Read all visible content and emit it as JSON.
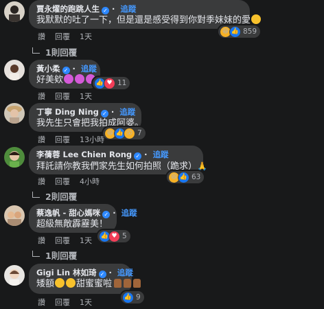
{
  "comments": [
    {
      "name": "賈永燿的跑跳人生",
      "verified_label": "✓",
      "follow_label": "追蹤",
      "text": "我默默的吐了一下，但是還是感受得到你對季妹妹的愛",
      "emoji_suffix": [
        "heart-eyes-emoji"
      ],
      "like_label": "讚",
      "reply_label": "回覆",
      "time": "1天",
      "reactions": [
        "haha",
        "like"
      ],
      "reaction_count": "859",
      "replies_label": "1則回覆"
    },
    {
      "name": "黃小柔",
      "verified_label": "✓",
      "follow_label": "追蹤",
      "text": "好美欸",
      "emoji_suffix": [
        "devil-emoji",
        "devil-emoji",
        "devil-emoji"
      ],
      "like_label": "讚",
      "reply_label": "回覆",
      "time": "1天",
      "reactions": [
        "like",
        "love"
      ],
      "reaction_count": "11"
    },
    {
      "name": "丁寧 Ding Ning",
      "verified_label": "✓",
      "follow_label": "追蹤",
      "text": "我先生只會把我拍成阿婆。",
      "like_label": "讚",
      "reply_label": "回覆",
      "time": "13小時",
      "reactions": [
        "haha",
        "like",
        "wow"
      ],
      "reaction_count": "7"
    },
    {
      "name": "李蒨蓉 Lee Chien Rong",
      "verified_label": "✓",
      "follow_label": "追蹤",
      "text": "拜託請你教我們家先生如何拍照（跪求）",
      "emoji_suffix": [
        "pray-emoji"
      ],
      "like_label": "讚",
      "reply_label": "回覆",
      "time": "4小時",
      "reactions": [
        "haha",
        "like"
      ],
      "reaction_count": "63",
      "replies_label": "2則回覆"
    },
    {
      "name": "蔡逸帆 - 甜心媽咪",
      "verified_label": "✓",
      "follow_label": "追蹤",
      "text": "超級無敵霹靂美！",
      "like_label": "讚",
      "reply_label": "回覆",
      "time": "1天",
      "reactions": [
        "like",
        "love"
      ],
      "reaction_count": "5",
      "replies_label": "1則回覆"
    },
    {
      "name": "Gigi Lin 林如琦",
      "verified_label": "✓",
      "follow_label": "追蹤",
      "text_a": "矮額",
      "text_b": "甜蜜蜜啦",
      "like_label": "讚",
      "reply_label": "回覆",
      "time": "1天",
      "reactions": [
        "like"
      ],
      "reaction_count": "9"
    }
  ],
  "colors": {
    "background": "#18191a",
    "bubble": "#3a3b3c",
    "link": "#4599ff",
    "muted": "#b0b3b8"
  }
}
